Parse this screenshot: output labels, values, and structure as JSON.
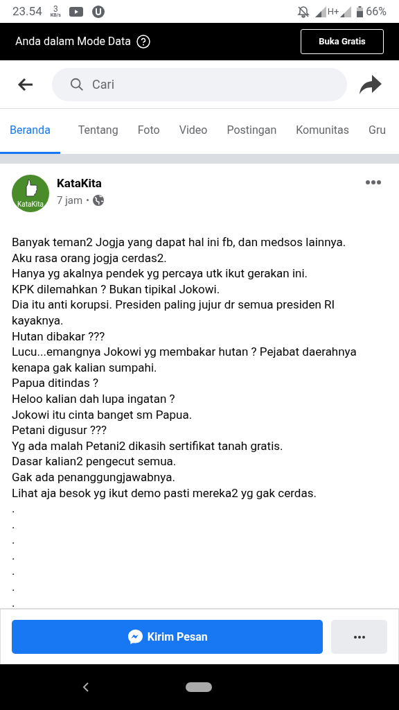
{
  "status_bar": {
    "time": "23.54",
    "speed_value": "3",
    "speed_unit": "KB/s",
    "network": "H+",
    "battery": "66%"
  },
  "data_banner": {
    "text": "Anda dalam Mode Data",
    "button": "Buka Gratis"
  },
  "search": {
    "placeholder": "Cari"
  },
  "tabs": [
    {
      "label": "Beranda",
      "selected": true
    },
    {
      "label": "Tentang",
      "selected": false
    },
    {
      "label": "Foto",
      "selected": false
    },
    {
      "label": "Video",
      "selected": false
    },
    {
      "label": "Postingan",
      "selected": false
    },
    {
      "label": "Komunitas",
      "selected": false
    },
    {
      "label": "Gru",
      "selected": false
    }
  ],
  "post": {
    "author": "KataKita",
    "avatar_text": "KataKita",
    "time": "7 jam",
    "lines": [
      "Banyak teman2 Jogja yang dapat hal ini fb, dan medsos lainnya.",
      "Aku rasa orang jogja cerdas2.",
      "Hanya yg akalnya pendek yg percaya utk ikut gerakan ini.",
      "KPK dilemahkan ? Bukan tipikal Jokowi.",
      "Dia itu anti korupsi. Presiden paling jujur dr semua presiden RI kayaknya.",
      "Hutan dibakar ???",
      "Lucu...emangnya Jokowi yg membakar hutan ? Pejabat daerahnya kenapa gak kalian sumpahi.",
      "Papua ditindas ?",
      "Heloo kalian dah lupa ingatan ?",
      "Jokowi itu cinta banget sm Papua.",
      "Petani digusur ???",
      "Yg ada malah Petani2 dikasih sertifikat tanah gratis.",
      "Dasar kalian2 pengecut semua.",
      "Gak ada penanggungjawabnya.",
      "Lihat aja besok yg ikut demo pasti mereka2 yg gak cerdas.",
      ".",
      ".",
      ".",
      ".",
      ".",
      ".",
      "."
    ]
  },
  "actions": {
    "message_button": "Kirim Pesan"
  }
}
